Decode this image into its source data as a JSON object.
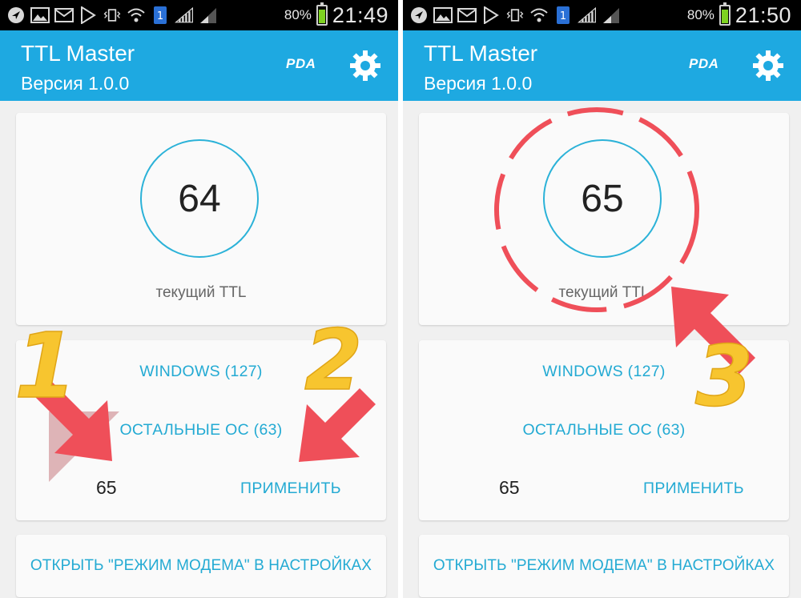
{
  "screens": [
    {
      "status": {
        "battery": "80%",
        "time": "21:49"
      },
      "app": {
        "title": "TTL Master",
        "version": "Версия 1.0.0",
        "logo": "PDA"
      },
      "ttl": {
        "value": "64",
        "label": "текущий TTL"
      },
      "buttons": {
        "windows": "WINDOWS (127)",
        "other_os": "ОСТАЛЬНЫЕ ОС (63)",
        "apply": "ПРИМЕНИТЬ",
        "modem": "ОТКРЫТЬ \"РЕЖИМ МОДЕМА\" В НАСТРОЙКАХ"
      },
      "input": {
        "value": "65"
      }
    },
    {
      "status": {
        "battery": "80%",
        "time": "21:50"
      },
      "app": {
        "title": "TTL Master",
        "version": "Версия 1.0.0",
        "logo": "PDA"
      },
      "ttl": {
        "value": "65",
        "label": "текущий TTL"
      },
      "buttons": {
        "windows": "WINDOWS (127)",
        "other_os": "ОСТАЛЬНЫЕ ОС (63)",
        "apply": "ПРИМЕНИТЬ",
        "modem": "ОТКРЫТЬ \"РЕЖИМ МОДЕМА\" В НАСТРОЙКАХ"
      },
      "input": {
        "value": "65"
      }
    }
  ],
  "annotations": {
    "step1": "1",
    "step2": "2",
    "step3": "3"
  },
  "colors": {
    "appbar": "#1ea9e1",
    "accent": "#23aad3",
    "arrow": "#ef4f59",
    "step_number": "#f7c52f"
  }
}
